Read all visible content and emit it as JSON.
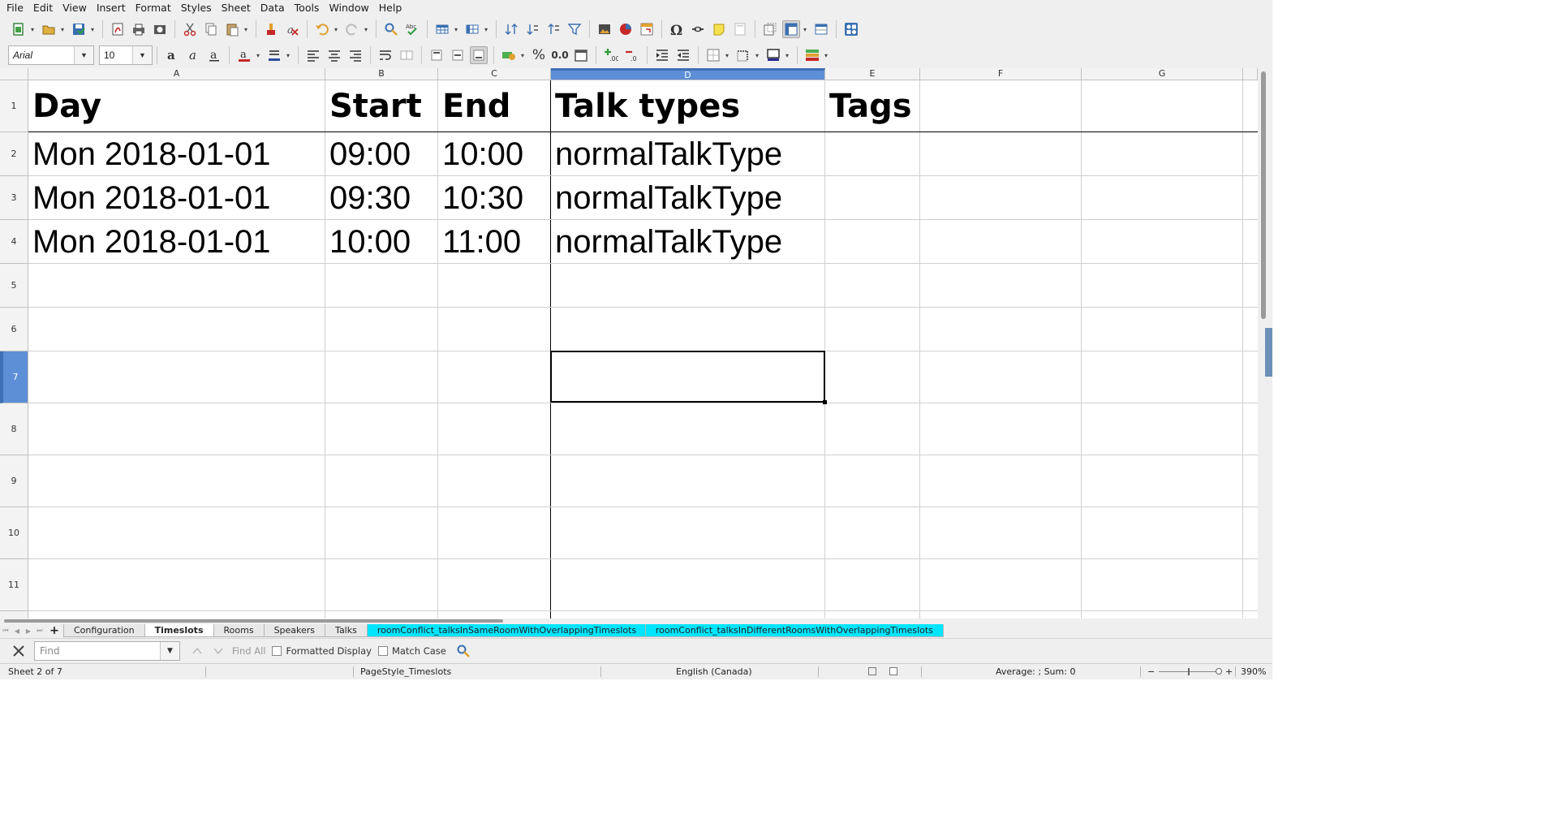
{
  "menu": [
    "File",
    "Edit",
    "View",
    "Insert",
    "Format",
    "Styles",
    "Sheet",
    "Data",
    "Tools",
    "Window",
    "Help"
  ],
  "font": {
    "name": "Arial",
    "size": "10"
  },
  "toolbar": {
    "percent_symbol": "%",
    "decimal_label": "0.0"
  },
  "columns": [
    "A",
    "B",
    "C",
    "D",
    "E",
    "F",
    "G"
  ],
  "rows": [
    "1",
    "2",
    "3",
    "4",
    "5",
    "6",
    "7",
    "8",
    "9",
    "10",
    "11"
  ],
  "active_cell": "D7",
  "headers": {
    "day": "Day",
    "start": "Start",
    "end": "End",
    "talk_types": "Talk types",
    "tags": "Tags"
  },
  "table": [
    {
      "day": "Mon 2018-01-01",
      "start": "09:00",
      "end": "10:00",
      "type": "normalTalkType"
    },
    {
      "day": "Mon 2018-01-01",
      "start": "09:30",
      "end": "10:30",
      "type": "normalTalkType"
    },
    {
      "day": "Mon 2018-01-01",
      "start": "10:00",
      "end": "11:00",
      "type": "normalTalkType"
    }
  ],
  "tabs": [
    "Configuration",
    "Timeslots",
    "Rooms",
    "Speakers",
    "Talks",
    "roomConflict_talksInSameRoomWithOverlappingTimeslots",
    "roomConflict_talksInDifferentRoomsWithOverlappingTimeslots"
  ],
  "active_tab": "Timeslots",
  "tab_highlight_color": "#00e5ff",
  "find": {
    "placeholder": "Find",
    "find_all": "Find All",
    "formatted_display": "Formatted Display",
    "match_case": "Match Case"
  },
  "status": {
    "sheet": "Sheet 2 of 7",
    "page_style": "PageStyle_Timeslots",
    "language": "English (Canada)",
    "summary": "Average: ; Sum: 0",
    "zoom": "390%"
  },
  "icons": [
    "new-icon",
    "open-icon",
    "save-icon",
    "export-pdf-icon",
    "print-icon",
    "print-preview-icon",
    "cut-icon",
    "copy-icon",
    "paste-icon",
    "clone-formatting-icon",
    "clear-formatting-icon",
    "undo-icon",
    "redo-icon",
    "find-replace-icon",
    "spelling-icon",
    "row-icon",
    "column-icon",
    "sort-icon",
    "sort-ascending-icon",
    "sort-descending-icon",
    "autofilter-icon",
    "image-icon",
    "chart-icon",
    "pivot-table-icon",
    "special-character-icon",
    "hyperlink-icon",
    "comment-icon",
    "headers-footers-icon",
    "define-print-area-icon",
    "freeze-rows-columns-icon",
    "split-window-icon",
    "show-draw-functions-icon"
  ],
  "accent_color": "#5d8fd6"
}
